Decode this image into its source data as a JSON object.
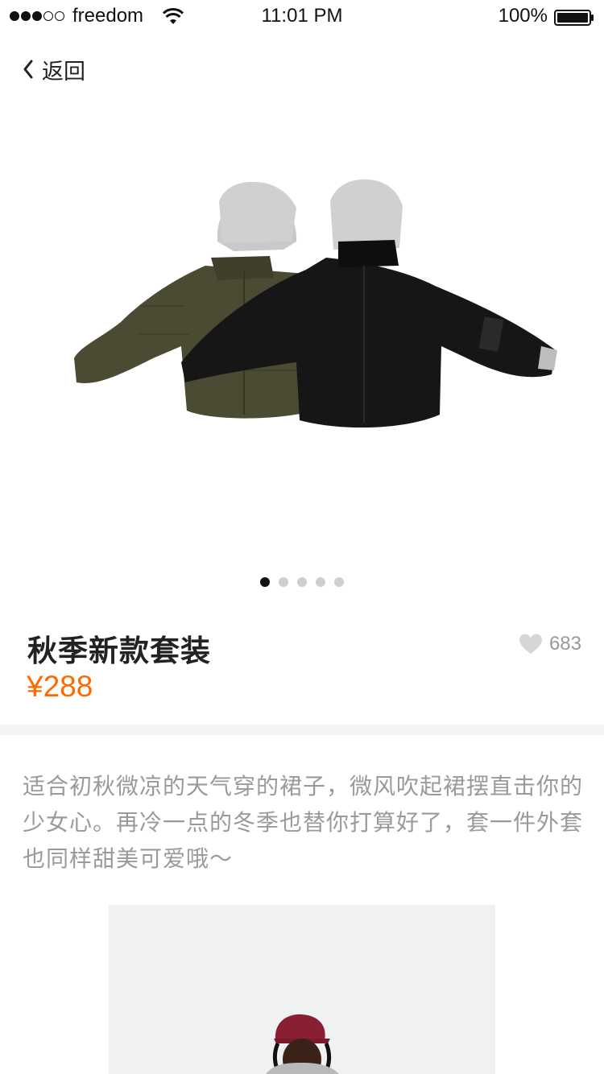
{
  "status_bar": {
    "carrier": "freedom",
    "time": "11:01 PM",
    "battery_percent": "100%",
    "signal_bars": 3,
    "signal_total": 5
  },
  "nav": {
    "back_label": "返回"
  },
  "gallery": {
    "page_count": 5,
    "active_index": 0
  },
  "product": {
    "title": "秋季新款套装",
    "price": "¥288",
    "like_count": "683"
  },
  "description": "适合初秋微凉的天气穿的裙子，微风吹起裙摆直击你的少女心。再冷一点的冬季也替你打算好了，套一件外套也同样甜美可爱哦～",
  "colors": {
    "price": "#ff6a00",
    "muted_text": "#9a9a9a",
    "jacket_olive": "#4a4a32",
    "jacket_black": "#151515",
    "hood_grey": "#c9cacc"
  }
}
